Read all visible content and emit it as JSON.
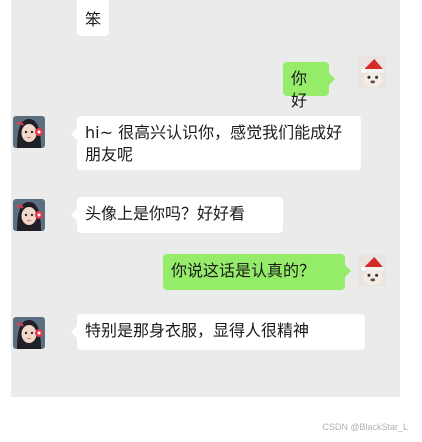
{
  "chat": {
    "messages": [
      {
        "side": "in",
        "text": "笨"
      },
      {
        "side": "out",
        "text": "你好"
      },
      {
        "side": "in",
        "text": "hi~ 很高兴认识你，感觉我们能成好朋友呢"
      },
      {
        "side": "in",
        "text": "头像上是你吗？好好看"
      },
      {
        "side": "out",
        "text": "你说这话是认真的？"
      },
      {
        "side": "in",
        "text": "特别是那身衣服，显得人很精神"
      }
    ]
  },
  "colors": {
    "chat_background": "#ebebeb",
    "incoming_bubble": "#ffffff",
    "outgoing_bubble": "#95ec69"
  },
  "icons": {
    "contact_avatar": "girl-avatar-icon",
    "self_avatar": "santa-hat-dog-avatar-icon"
  },
  "watermark": "CSDN @BlackStar_L"
}
